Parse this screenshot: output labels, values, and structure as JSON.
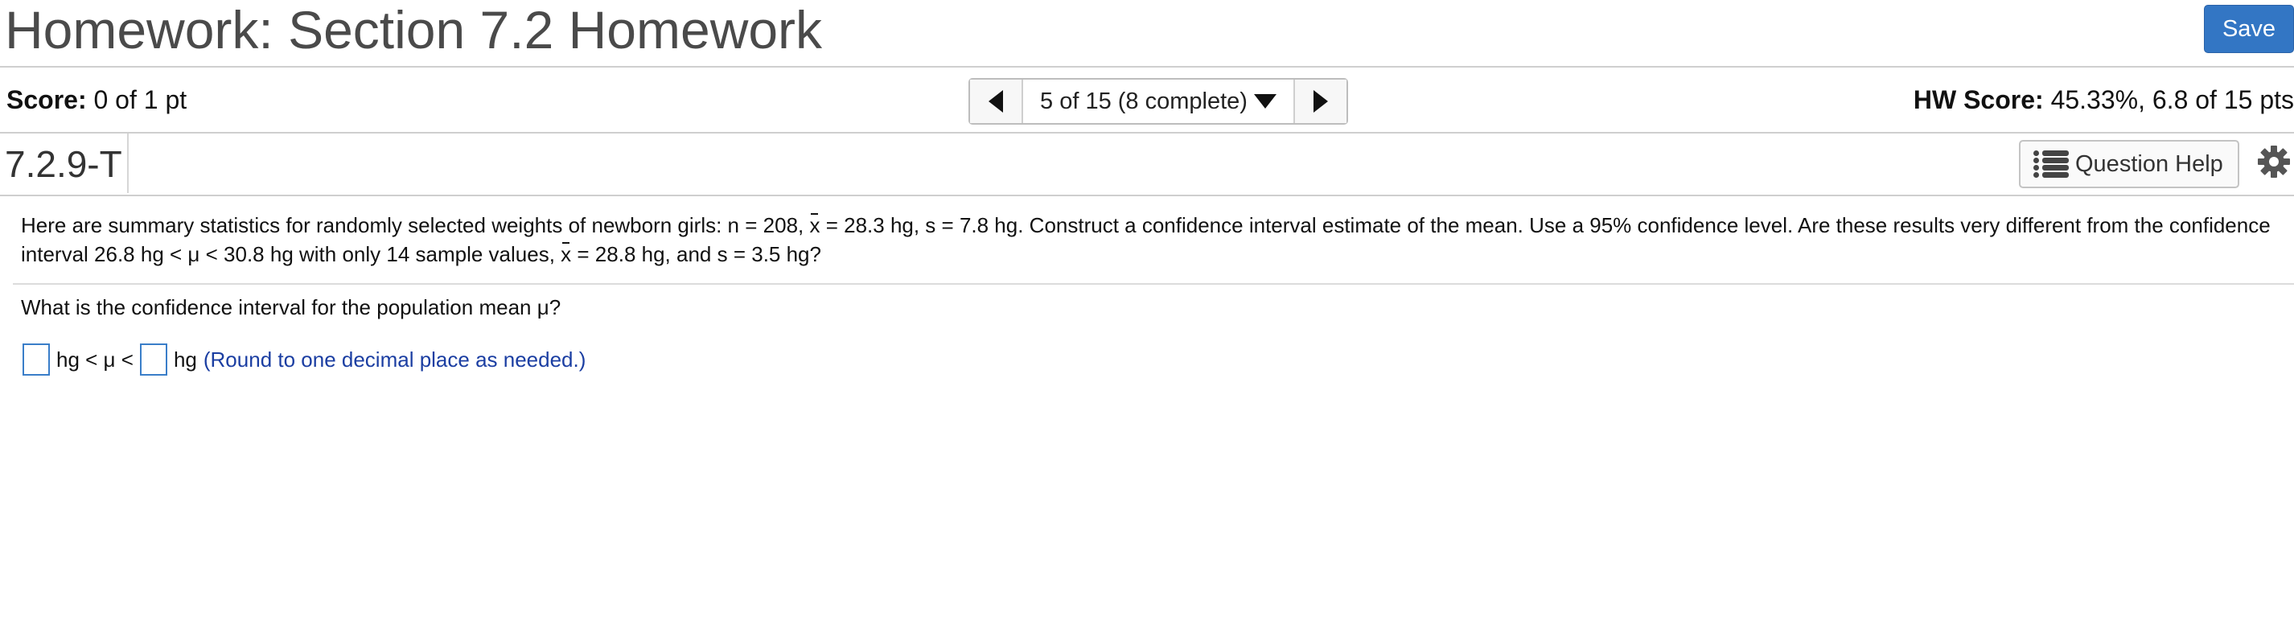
{
  "header": {
    "title": "Homework: Section 7.2 Homework",
    "save_label": "Save"
  },
  "score": {
    "label": "Score:",
    "value": "0 of 1 pt"
  },
  "navigator": {
    "position_text": "5 of 15 (8 complete)",
    "prev_icon": "triangle-left-icon",
    "next_icon": "triangle-right-icon",
    "dropdown_icon": "triangle-down-icon"
  },
  "hw_score": {
    "label": "HW Score:",
    "value": "45.33%, 6.8 of 15 pts"
  },
  "question": {
    "id": "7.2.9-T",
    "help_label": "Question Help",
    "help_icon": "list-icon",
    "settings_icon": "gear-icon",
    "text_part1": "Here are summary statistics for randomly selected weights of newborn girls: n = 208, ",
    "xbar_symbol": "x",
    "text_part2": " = 28.3 hg, s = 7.8 hg. Construct a confidence interval estimate of the mean. Use a 95% confidence level. Are these results very different from the confidence interval 26.8 hg < μ < 30.8 hg with only 14 sample values, ",
    "text_part3": " = 28.8 hg, and s = 3.5 hg?",
    "prompt": "What is the confidence interval for the population mean μ?",
    "answer_unit_1": "hg < μ <",
    "answer_unit_2": "hg",
    "hint": "(Round to one decimal place as needed.)"
  },
  "colors": {
    "save_button": "#3376c4",
    "hint_text": "#1b3ea2",
    "input_border": "#3a7ec9"
  }
}
